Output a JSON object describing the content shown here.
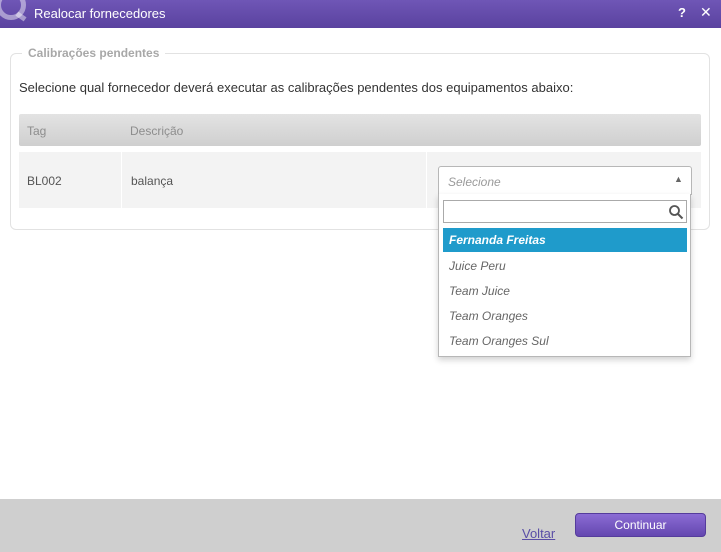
{
  "window": {
    "title": "Realocar fornecedores",
    "help_label": "?",
    "close_label": "✕"
  },
  "section": {
    "legend": "Calibrações pendentes",
    "instruction": "Selecione qual fornecedor deverá executar as calibrações pendentes dos equipamentos abaixo:"
  },
  "table": {
    "columns": [
      "Tag",
      "Descrição"
    ],
    "rows": [
      {
        "tag": "BL002",
        "description": "balança"
      }
    ]
  },
  "supplier_select": {
    "placeholder": "Selecione",
    "search_value": "",
    "options": [
      "Fernanda Freitas",
      "Juice Peru",
      "Team Juice",
      "Team Oranges",
      "Team Oranges Sul"
    ],
    "highlighted": "Fernanda Freitas"
  },
  "footer": {
    "back_label": "Voltar",
    "continue_label": "Continuar"
  },
  "colors": {
    "titlebar": "#5a429f",
    "highlight": "#1f9bcb",
    "button": "#6447b0"
  }
}
